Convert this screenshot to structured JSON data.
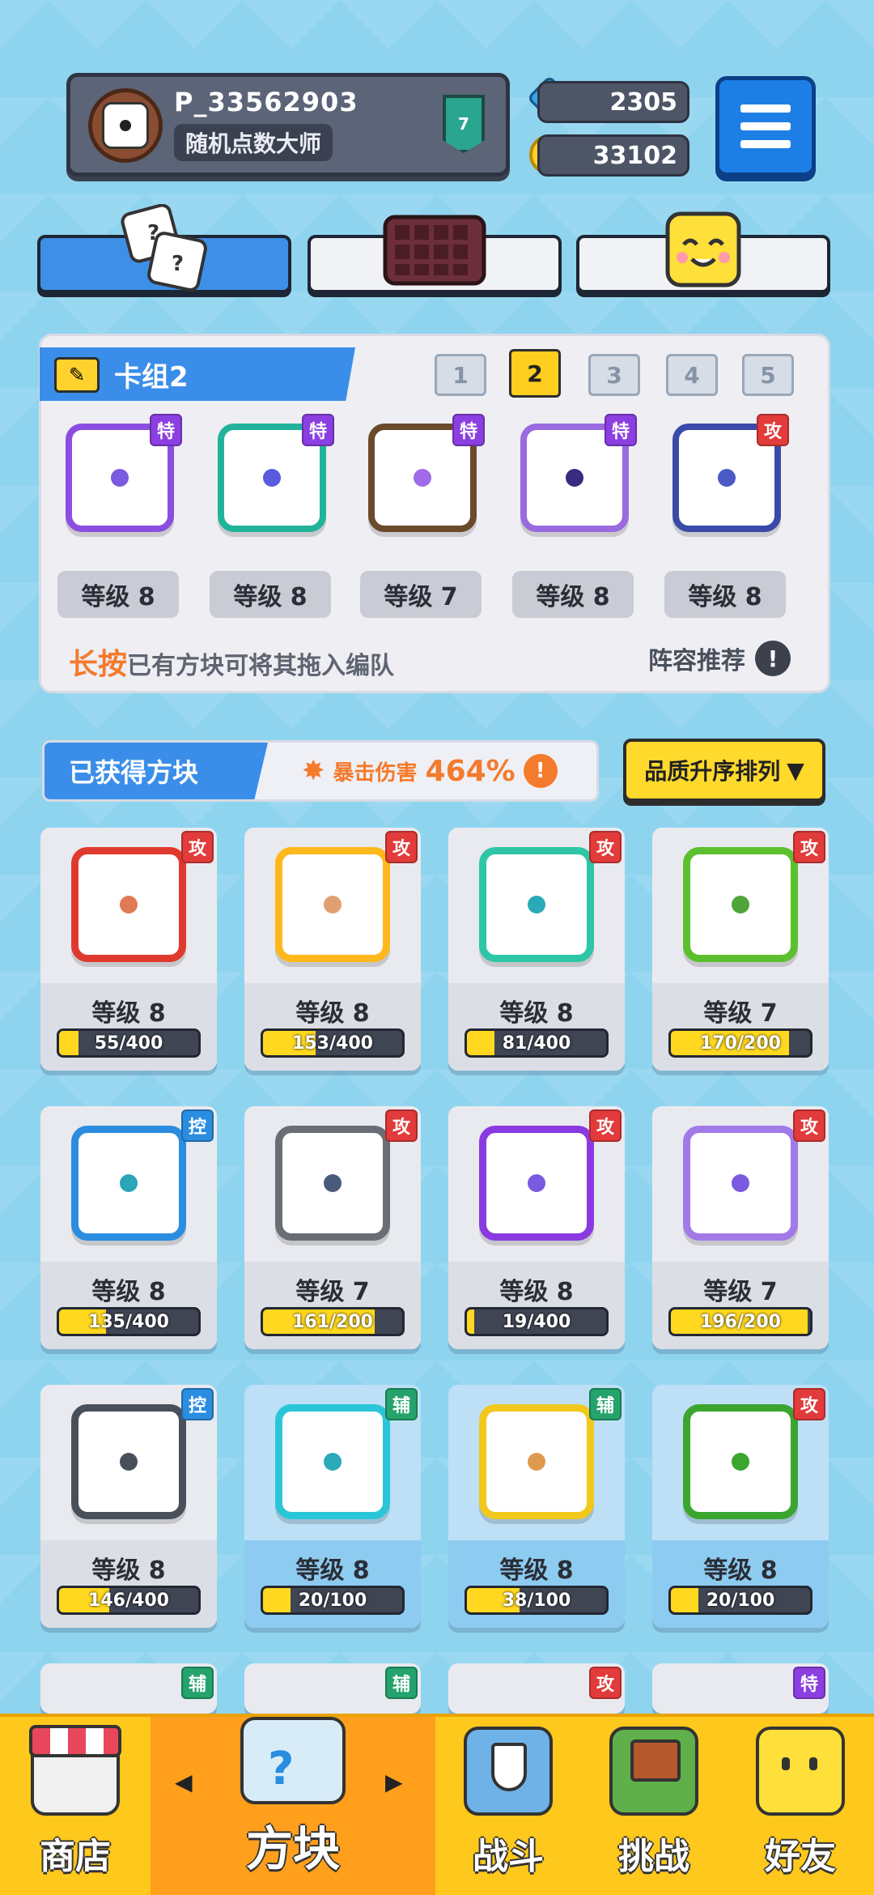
{
  "profile": {
    "name": "P_33562903",
    "title": "随机点数大师",
    "rank": "7"
  },
  "resources": {
    "gems": "2305",
    "coins": "33102"
  },
  "deck": {
    "title": "卡组2",
    "numbers": [
      "1",
      "2",
      "3",
      "4",
      "5"
    ],
    "active_number": "2",
    "cards": [
      {
        "level": "等级 8",
        "tag": "特",
        "tag_type": "te",
        "color": "#8a4fe0",
        "pip": "#7a5ae0"
      },
      {
        "level": "等级 8",
        "tag": "特",
        "tag_type": "te",
        "color": "#20b39a",
        "pip": "#5a5adf"
      },
      {
        "level": "等级 7",
        "tag": "特",
        "tag_type": "te",
        "color": "#6a4a2a",
        "pip": "#a06ae8"
      },
      {
        "level": "等级 8",
        "tag": "特",
        "tag_type": "te",
        "color": "#9a6ae0",
        "pip": "#3a2a80"
      },
      {
        "level": "等级 8",
        "tag": "攻",
        "tag_type": "gong",
        "color": "#3a4aa8",
        "pip": "#4a5ac8"
      }
    ],
    "hint_strong": "长按",
    "hint_rest": "已有方块可将其拖入编队",
    "recommend": "阵容推荐"
  },
  "owned": {
    "title": "已获得方块",
    "crit_label": "暴击伤害",
    "crit_value": "464%",
    "sort_label": "品质升序排列"
  },
  "blocks": [
    {
      "level": "等级 8",
      "progress": "55/400",
      "ratio": 0.14,
      "tag": "攻",
      "tag_type": "gong",
      "color": "#e03a2e",
      "pip": "#e07a55",
      "blue": false
    },
    {
      "level": "等级 8",
      "progress": "153/400",
      "ratio": 0.38,
      "tag": "攻",
      "tag_type": "gong",
      "color": "#ffb81c",
      "pip": "#e0a070",
      "blue": false
    },
    {
      "level": "等级 8",
      "progress": "81/400",
      "ratio": 0.2,
      "tag": "攻",
      "tag_type": "gong",
      "color": "#2ec6a6",
      "pip": "#2aaab8",
      "blue": false
    },
    {
      "level": "等级 7",
      "progress": "170/200",
      "ratio": 0.85,
      "tag": "攻",
      "tag_type": "gong",
      "color": "#5cc02e",
      "pip": "#4ea63a",
      "blue": false
    },
    {
      "level": "等级 8",
      "progress": "135/400",
      "ratio": 0.34,
      "tag": "控",
      "tag_type": "kong",
      "color": "#2a8de0",
      "pip": "#2aa6b8",
      "blue": false
    },
    {
      "level": "等级 7",
      "progress": "161/200",
      "ratio": 0.8,
      "tag": "攻",
      "tag_type": "gong",
      "color": "#6a6d74",
      "pip": "#4a5a7a",
      "blue": false
    },
    {
      "level": "等级 8",
      "progress": "19/400",
      "ratio": 0.05,
      "tag": "攻",
      "tag_type": "gong",
      "color": "#8a3ae0",
      "pip": "#7a5ae0",
      "blue": false
    },
    {
      "level": "等级 7",
      "progress": "196/200",
      "ratio": 0.98,
      "tag": "攻",
      "tag_type": "gong",
      "color": "#a27ae8",
      "pip": "#7a5ae0",
      "blue": false
    },
    {
      "level": "等级 8",
      "progress": "146/400",
      "ratio": 0.36,
      "tag": "控",
      "tag_type": "kong",
      "color": "#4a4f5c",
      "pip": "#4a4f5c",
      "blue": false
    },
    {
      "level": "等级 8",
      "progress": "20/100",
      "ratio": 0.2,
      "tag": "辅",
      "tag_type": "fu",
      "color": "#2ac6d8",
      "pip": "#2aaab8",
      "blue": true
    },
    {
      "level": "等级 8",
      "progress": "38/100",
      "ratio": 0.38,
      "tag": "辅",
      "tag_type": "fu",
      "color": "#f2c81c",
      "pip": "#e09a50",
      "blue": true
    },
    {
      "level": "等级 8",
      "progress": "20/100",
      "ratio": 0.2,
      "tag": "攻",
      "tag_type": "gong",
      "color": "#3aa62e",
      "pip": "#3aa62e",
      "blue": true
    }
  ],
  "partial_tags": [
    {
      "tag": "辅",
      "tag_type": "fu"
    },
    {
      "tag": "辅",
      "tag_type": "fu"
    },
    {
      "tag": "攻",
      "tag_type": "gong"
    },
    {
      "tag": "特",
      "tag_type": "te"
    }
  ],
  "nav": {
    "shop": "商店",
    "blocks": "方块",
    "battle": "战斗",
    "challenge": "挑战",
    "friends": "好友"
  }
}
